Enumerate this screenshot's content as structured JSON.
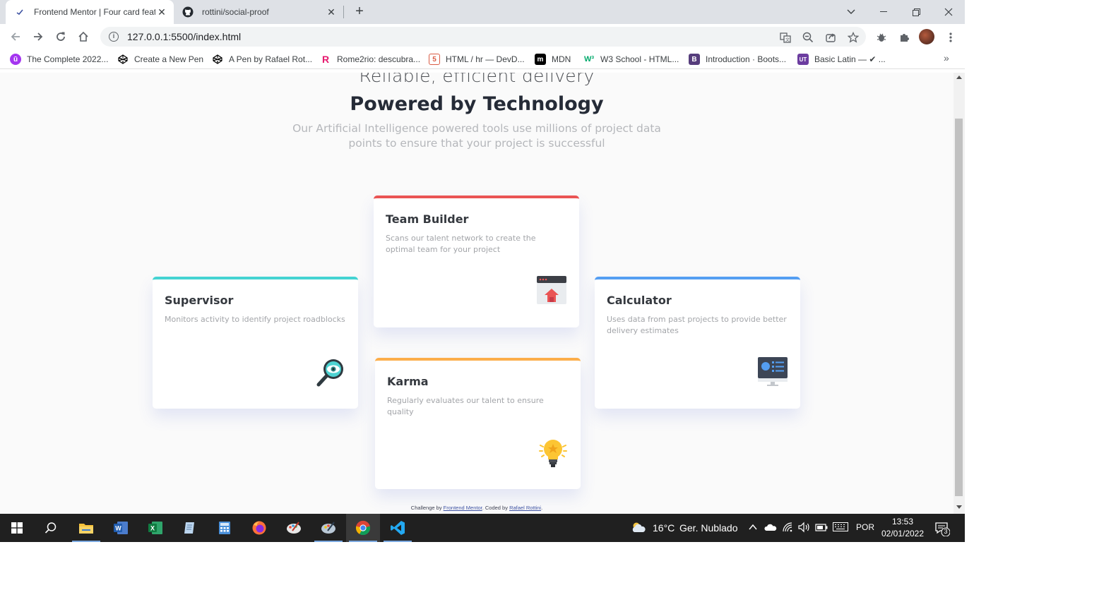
{
  "browser": {
    "tabs": [
      {
        "title": "Frontend Mentor | Four card feat",
        "active": true
      },
      {
        "title": "rottini/social-proof",
        "active": false
      }
    ],
    "url": "127.0.0.1:5500/index.html",
    "bookmarks": [
      {
        "label": "The Complete 2022...",
        "icon": "udemy-icon",
        "color": "#a435f0"
      },
      {
        "label": "Create a New Pen",
        "icon": "codepen-icon",
        "color": "#000000"
      },
      {
        "label": "A Pen by Rafael Rot...",
        "icon": "codepen-icon",
        "color": "#000000"
      },
      {
        "label": "Rome2rio: descubra...",
        "icon": "rome2rio-icon",
        "color": "#e6196e"
      },
      {
        "label": "HTML / hr — DevD...",
        "icon": "devdocs-icon",
        "color": "#d95c45"
      },
      {
        "label": "MDN",
        "icon": "mdn-icon",
        "color": "#000000"
      },
      {
        "label": "W3 School - HTML...",
        "icon": "w3schools-icon",
        "color": "#04aa6d"
      },
      {
        "label": "Introduction · Boots...",
        "icon": "bootstrap-icon",
        "color": "#563d7c"
      },
      {
        "label": "Basic Latin — ✔ ...",
        "icon": "ut-icon",
        "color": "#6c3da0"
      }
    ],
    "more": "»"
  },
  "page": {
    "hero_light": "Reliable, efficient delivery",
    "hero_bold": "Powered by Technology",
    "hero_sub": "Our Artificial Intelligence powered tools use millions of project data points to ensure that your project is successful",
    "cards": {
      "supervisor": {
        "title": "Supervisor",
        "text": "Monitors activity to identify project roadblocks",
        "accent": "#44d3d2"
      },
      "team_builder": {
        "title": "Team Builder",
        "text": "Scans our talent network to create the optimal team for your project",
        "accent": "#ea5454"
      },
      "karma": {
        "title": "Karma",
        "text": "Regularly evaluates our talent to ensure quality",
        "accent": "#fcae4a"
      },
      "calculator": {
        "title": "Calculator",
        "text": "Uses data from past projects to provide better delivery estimates",
        "accent": "#549ef2"
      }
    },
    "attribution": {
      "prefix": "Challenge by ",
      "link1": "Frontend Mentor",
      "middle": ". Coded by ",
      "link2": "Rafael Rottini",
      "suffix": "."
    }
  },
  "taskbar": {
    "weather_temp": "16°C",
    "weather_text": "Ger. Nublado",
    "language": "POR",
    "time": "13:53",
    "date": "02/01/2022",
    "notifications": "3"
  }
}
